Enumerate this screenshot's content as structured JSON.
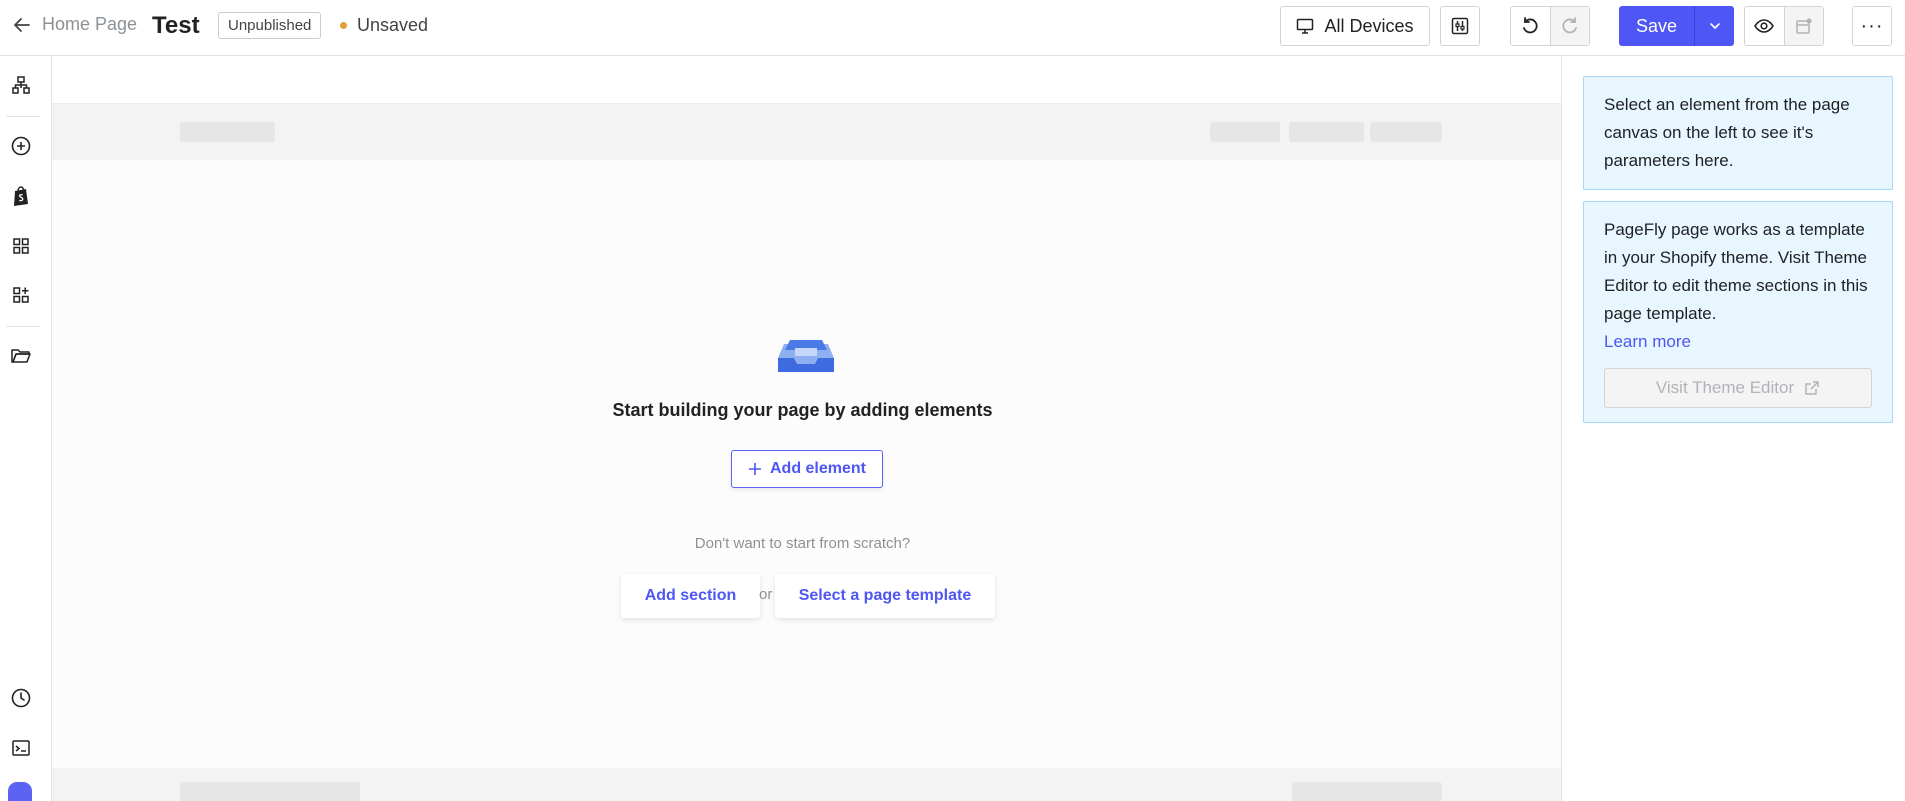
{
  "topbar": {
    "back_label": "Home Page",
    "page_title": "Test",
    "status_badge": "Unpublished",
    "save_state": "Unsaved",
    "devices_label": "All Devices",
    "save_label": "Save",
    "more_label": "···"
  },
  "canvas": {
    "empty_title": "Start building your page by adding elements",
    "add_element_label": "Add element",
    "scratch_text": "Don't want to start from scratch?",
    "add_section_label": "Add section",
    "or_text": "or",
    "select_template_label": "Select a page template"
  },
  "panel": {
    "select_hint": "Select an element from the page canvas on the left to see it's parameters here.",
    "theme_info": "PageFly page works as a template in your Shopify theme. Visit Theme Editor to edit theme sections in this page template.",
    "learn_more": "Learn more",
    "visit_theme_editor": "Visit Theme Editor"
  },
  "rail": {
    "items": [
      "page-structure-icon",
      "add-element-icon",
      "shopify-icon",
      "sections-icon",
      "apps-icon",
      "folder-icon",
      "history-icon",
      "terminal-icon"
    ]
  },
  "colors": {
    "accent": "#4e56f5",
    "info_bg": "#e8f6ff",
    "info_border": "#a4d8f5",
    "unsaved_dot": "#e0a03a"
  }
}
